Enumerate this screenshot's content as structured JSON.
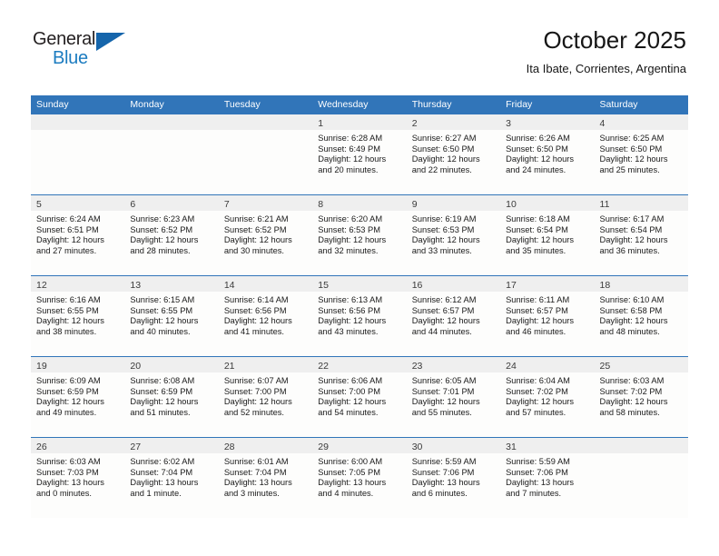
{
  "brand": {
    "name_top": "General",
    "name_bottom": "Blue",
    "triangle_icon": "triangle-icon",
    "color_dark": "#231f20",
    "color_blue": "#1c7cc0"
  },
  "header": {
    "title": "October 2025",
    "subtitle": "Ita Ibate, Corrientes, Argentina"
  },
  "theme": {
    "header_blue": "#3175b9",
    "daynum_band": "#efefef",
    "cell_background": "#fdfdfc"
  },
  "weekdays": [
    "Sunday",
    "Monday",
    "Tuesday",
    "Wednesday",
    "Thursday",
    "Friday",
    "Saturday"
  ],
  "weeks": [
    [
      {
        "empty": true
      },
      {
        "empty": true
      },
      {
        "empty": true
      },
      {
        "day": "1",
        "sunrise": "Sunrise: 6:28 AM",
        "sunset": "Sunset: 6:49 PM",
        "daylight": "Daylight: 12 hours and 20 minutes."
      },
      {
        "day": "2",
        "sunrise": "Sunrise: 6:27 AM",
        "sunset": "Sunset: 6:50 PM",
        "daylight": "Daylight: 12 hours and 22 minutes."
      },
      {
        "day": "3",
        "sunrise": "Sunrise: 6:26 AM",
        "sunset": "Sunset: 6:50 PM",
        "daylight": "Daylight: 12 hours and 24 minutes."
      },
      {
        "day": "4",
        "sunrise": "Sunrise: 6:25 AM",
        "sunset": "Sunset: 6:50 PM",
        "daylight": "Daylight: 12 hours and 25 minutes."
      }
    ],
    [
      {
        "day": "5",
        "sunrise": "Sunrise: 6:24 AM",
        "sunset": "Sunset: 6:51 PM",
        "daylight": "Daylight: 12 hours and 27 minutes."
      },
      {
        "day": "6",
        "sunrise": "Sunrise: 6:23 AM",
        "sunset": "Sunset: 6:52 PM",
        "daylight": "Daylight: 12 hours and 28 minutes."
      },
      {
        "day": "7",
        "sunrise": "Sunrise: 6:21 AM",
        "sunset": "Sunset: 6:52 PM",
        "daylight": "Daylight: 12 hours and 30 minutes."
      },
      {
        "day": "8",
        "sunrise": "Sunrise: 6:20 AM",
        "sunset": "Sunset: 6:53 PM",
        "daylight": "Daylight: 12 hours and 32 minutes."
      },
      {
        "day": "9",
        "sunrise": "Sunrise: 6:19 AM",
        "sunset": "Sunset: 6:53 PM",
        "daylight": "Daylight: 12 hours and 33 minutes."
      },
      {
        "day": "10",
        "sunrise": "Sunrise: 6:18 AM",
        "sunset": "Sunset: 6:54 PM",
        "daylight": "Daylight: 12 hours and 35 minutes."
      },
      {
        "day": "11",
        "sunrise": "Sunrise: 6:17 AM",
        "sunset": "Sunset: 6:54 PM",
        "daylight": "Daylight: 12 hours and 36 minutes."
      }
    ],
    [
      {
        "day": "12",
        "sunrise": "Sunrise: 6:16 AM",
        "sunset": "Sunset: 6:55 PM",
        "daylight": "Daylight: 12 hours and 38 minutes."
      },
      {
        "day": "13",
        "sunrise": "Sunrise: 6:15 AM",
        "sunset": "Sunset: 6:55 PM",
        "daylight": "Daylight: 12 hours and 40 minutes."
      },
      {
        "day": "14",
        "sunrise": "Sunrise: 6:14 AM",
        "sunset": "Sunset: 6:56 PM",
        "daylight": "Daylight: 12 hours and 41 minutes."
      },
      {
        "day": "15",
        "sunrise": "Sunrise: 6:13 AM",
        "sunset": "Sunset: 6:56 PM",
        "daylight": "Daylight: 12 hours and 43 minutes."
      },
      {
        "day": "16",
        "sunrise": "Sunrise: 6:12 AM",
        "sunset": "Sunset: 6:57 PM",
        "daylight": "Daylight: 12 hours and 44 minutes."
      },
      {
        "day": "17",
        "sunrise": "Sunrise: 6:11 AM",
        "sunset": "Sunset: 6:57 PM",
        "daylight": "Daylight: 12 hours and 46 minutes."
      },
      {
        "day": "18",
        "sunrise": "Sunrise: 6:10 AM",
        "sunset": "Sunset: 6:58 PM",
        "daylight": "Daylight: 12 hours and 48 minutes."
      }
    ],
    [
      {
        "day": "19",
        "sunrise": "Sunrise: 6:09 AM",
        "sunset": "Sunset: 6:59 PM",
        "daylight": "Daylight: 12 hours and 49 minutes."
      },
      {
        "day": "20",
        "sunrise": "Sunrise: 6:08 AM",
        "sunset": "Sunset: 6:59 PM",
        "daylight": "Daylight: 12 hours and 51 minutes."
      },
      {
        "day": "21",
        "sunrise": "Sunrise: 6:07 AM",
        "sunset": "Sunset: 7:00 PM",
        "daylight": "Daylight: 12 hours and 52 minutes."
      },
      {
        "day": "22",
        "sunrise": "Sunrise: 6:06 AM",
        "sunset": "Sunset: 7:00 PM",
        "daylight": "Daylight: 12 hours and 54 minutes."
      },
      {
        "day": "23",
        "sunrise": "Sunrise: 6:05 AM",
        "sunset": "Sunset: 7:01 PM",
        "daylight": "Daylight: 12 hours and 55 minutes."
      },
      {
        "day": "24",
        "sunrise": "Sunrise: 6:04 AM",
        "sunset": "Sunset: 7:02 PM",
        "daylight": "Daylight: 12 hours and 57 minutes."
      },
      {
        "day": "25",
        "sunrise": "Sunrise: 6:03 AM",
        "sunset": "Sunset: 7:02 PM",
        "daylight": "Daylight: 12 hours and 58 minutes."
      }
    ],
    [
      {
        "day": "26",
        "sunrise": "Sunrise: 6:03 AM",
        "sunset": "Sunset: 7:03 PM",
        "daylight": "Daylight: 13 hours and 0 minutes."
      },
      {
        "day": "27",
        "sunrise": "Sunrise: 6:02 AM",
        "sunset": "Sunset: 7:04 PM",
        "daylight": "Daylight: 13 hours and 1 minute."
      },
      {
        "day": "28",
        "sunrise": "Sunrise: 6:01 AM",
        "sunset": "Sunset: 7:04 PM",
        "daylight": "Daylight: 13 hours and 3 minutes."
      },
      {
        "day": "29",
        "sunrise": "Sunrise: 6:00 AM",
        "sunset": "Sunset: 7:05 PM",
        "daylight": "Daylight: 13 hours and 4 minutes."
      },
      {
        "day": "30",
        "sunrise": "Sunrise: 5:59 AM",
        "sunset": "Sunset: 7:06 PM",
        "daylight": "Daylight: 13 hours and 6 minutes."
      },
      {
        "day": "31",
        "sunrise": "Sunrise: 5:59 AM",
        "sunset": "Sunset: 7:06 PM",
        "daylight": "Daylight: 13 hours and 7 minutes."
      },
      {
        "empty": true
      }
    ]
  ]
}
